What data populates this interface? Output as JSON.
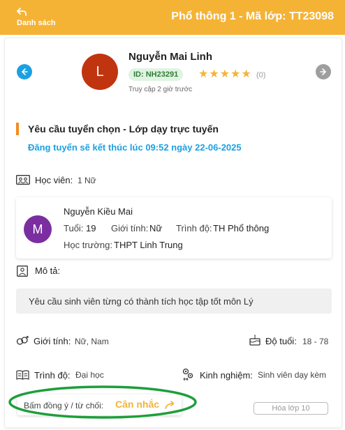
{
  "header": {
    "back_label": "Danh sách",
    "title": "Phổ thông 1 - Mã lớp: TT23098"
  },
  "tutor": {
    "avatar_letter": "L",
    "name": "Nguyễn Mai Linh",
    "id_badge": "ID: NH23291",
    "stars": "★★★★★",
    "rating_count": "(0)",
    "last_access": "Truy cập 2 giờ trước"
  },
  "request": {
    "title": "Yêu cầu tuyển chọn - Lớp dạy trực tuyến",
    "deadline": "Đăng tuyển sẽ kết thúc lúc 09:52 ngày 22-06-2025"
  },
  "students": {
    "label": "Học viên:",
    "value": "1 Nữ"
  },
  "student": {
    "avatar_letter": "M",
    "name": "Nguyễn Kiều Mai",
    "age_label": "Tuổi:",
    "age": "19",
    "gender_label": "Giới tính:",
    "gender": "Nữ",
    "level_label": "Trình độ:",
    "level": "TH Phổ thông",
    "school_label": "Học trường:",
    "school": "THPT Linh Trung"
  },
  "description": {
    "label": "Mô tả:",
    "text": "Yêu cầu sinh viên từng có thành tích học tập tốt môn Lý"
  },
  "requirements": {
    "gender_label": "Giới tính:",
    "gender_value": "Nữ, Nam",
    "age_label": "Độ tuổi:",
    "age_value": "18 - 78",
    "level_label": "Trình độ:",
    "level_value": "Đại học",
    "experience_label": "Kinh nghiệm:",
    "experience_value": "Sinh viên dạy kèm"
  },
  "actions": {
    "prompt": "Bấm đồng ý / từ chối:",
    "consider_button": "Cân nhắc",
    "class_button": "Hóa lớp 10"
  },
  "colors": {
    "header": "#f5b335",
    "accent_blue": "#1ba1e2",
    "highlight_oval": "#1e9e3a"
  }
}
